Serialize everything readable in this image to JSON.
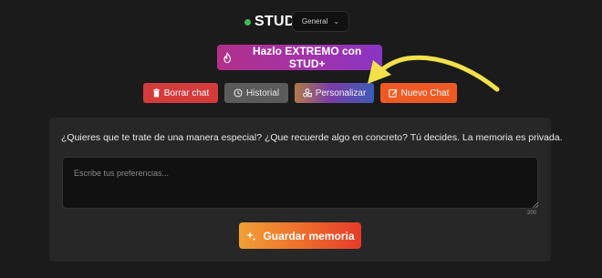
{
  "header": {
    "brand": "STUD",
    "mode_select": {
      "selected": "General"
    }
  },
  "extreme_button": {
    "label": "Hazlo EXTREMO con STUD+"
  },
  "actions": {
    "clear_label": "Borrar chat",
    "history_label": "Historial",
    "personalize_label": "Personalizar",
    "new_chat_label": "Nuevo Chat"
  },
  "memory": {
    "question": "¿Quieres que te trate de una manera especial? ¿Que recuerde algo en concreto? Tú decides. La memoria es privada.",
    "placeholder": "Escribe tus preferencias...",
    "value": "",
    "char_limit": "200",
    "save_label": "Guardar memoria"
  },
  "colors": {
    "status_dot": "#3fb950",
    "arrow": "#f2e14a",
    "clear_button": "#d43b3b",
    "history_button": "#5b5b5b",
    "new_chat_button": "#ef5a24"
  }
}
